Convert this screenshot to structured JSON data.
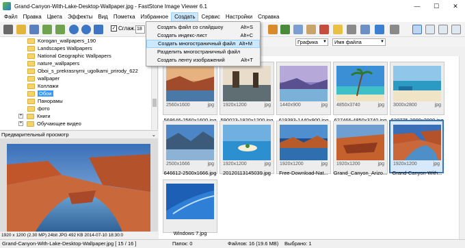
{
  "window": {
    "title": "Grand-Canyon-With-Lake-Desktop-Wallpaper.jpg  -  FastStone Image Viewer 6.1",
    "controls": [
      "—",
      "☐",
      "✕"
    ]
  },
  "menu": {
    "items": [
      "Файл",
      "Правка",
      "Цвета",
      "Эффекты",
      "Вид",
      "Пометка",
      "Избранное",
      "Создать",
      "Сервис",
      "Настройки",
      "Справка"
    ],
    "active": "Создать"
  },
  "toolbar": {
    "smooth_label": "Сглаж.",
    "smooth_checked": "✓",
    "zoom_value": "18"
  },
  "create_menu": {
    "items": [
      {
        "label": "Создать файл со слайдшоу",
        "shortcut": "Alt+S"
      },
      {
        "label": "Создать индекс-лист",
        "shortcut": "Alt+C"
      },
      {
        "label": "Создать многостраничный файл",
        "shortcut": "Alt+M"
      },
      {
        "label": "Разделить многостраничный файл",
        "shortcut": ""
      },
      {
        "label": "Создать ленту изображений",
        "shortcut": "Alt+T"
      }
    ],
    "highlighted_index": 2
  },
  "tree": {
    "items": [
      {
        "label": "Korogan_wallpapers_190"
      },
      {
        "label": "Landscapes Wallpapers"
      },
      {
        "label": "National Geographic Wallpapers"
      },
      {
        "label": "nature_wallpapers"
      },
      {
        "label": "Oboi_s_prekrasnymi_ugolkami_prirody_622"
      },
      {
        "label": "wallpaper"
      },
      {
        "label": "Коллажи"
      },
      {
        "label": "Обои",
        "selected": true
      },
      {
        "label": "Панорамы"
      },
      {
        "label": "фото"
      },
      {
        "label": "Книги",
        "expander": "+"
      },
      {
        "label": "Обучающее видео",
        "expander": "+"
      }
    ]
  },
  "preview": {
    "header": "Предварительный просмотр",
    "toggle": "⌄",
    "info": "1920 x 1200 (2.30 MP)  24bit  JPG  492 KB  2014-07-10 18:30:0"
  },
  "browser": {
    "filter_value": "Графика",
    "sort_value": "Имя файла",
    "thumbnails": [
      {
        "dims": "2560x1600",
        "ext": "jpg",
        "name": "568646-2560x1600.jpg",
        "selected": false
      },
      {
        "dims": "1920x1200",
        "ext": "jpg",
        "name": "590023-1920x1200.jpg",
        "selected": false
      },
      {
        "dims": "1440x900",
        "ext": "jpg",
        "name": "619393-1440x900.jpg",
        "selected": false
      },
      {
        "dims": "4850x3740",
        "ext": "jpg",
        "name": "627466-4850x3740.jpg",
        "selected": false
      },
      {
        "dims": "3000x2800",
        "ext": "jpg",
        "name": "628775-3000x2800.jpg",
        "selected": false
      },
      {
        "dims": "2500x1666",
        "ext": "jpg",
        "name": "646612-2500x1666.jpg",
        "selected": false
      },
      {
        "dims": "1920x1200",
        "ext": "jpg",
        "name": "20120113145039.jpg",
        "selected": false
      },
      {
        "dims": "1920x1200",
        "ext": "jpg",
        "name": "Free-Download-Nat...",
        "selected": false
      },
      {
        "dims": "1920x1200",
        "ext": "jpg",
        "name": "Grand_Canyon_Arizo...",
        "selected": false
      },
      {
        "dims": "1920x1200",
        "ext": "jpg",
        "name": "Grand-Canyon-With...",
        "selected": true
      },
      {
        "dims": "",
        "ext": "",
        "name": "Windows 7.jpg",
        "selected": false
      }
    ]
  },
  "status": {
    "file": "Grand-Canyon-With-Lake-Desktop-Wallpaper.jpg [ 15 / 16 ]",
    "folders": "Папок: 0",
    "files": "Файлов: 16 (19.6 MB)",
    "selected": "Выбрано: 1"
  }
}
